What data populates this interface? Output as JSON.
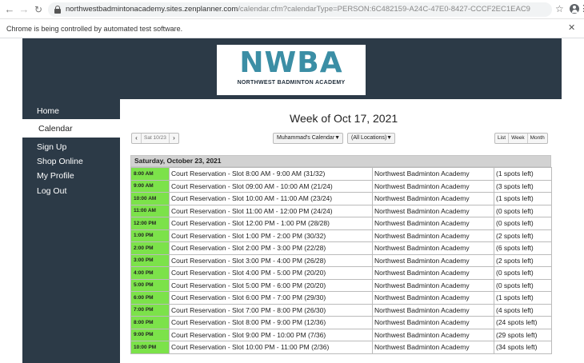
{
  "browser": {
    "url_domain": "northwestbadmintonacademy.sites.zenplanner.com",
    "url_path": "/calendar.cfm?calendarType=PERSON:6C482159-A24C-47E0-8427-CCCF2EC1EAC9",
    "infobar_text": "Chrome is being controlled by automated test software.",
    "icons": [
      "back-icon",
      "forward-icon",
      "reload-icon",
      "lock-icon",
      "star-icon",
      "profile-icon",
      "menu-icon",
      "close-icon"
    ]
  },
  "logo": {
    "text": "NWBA",
    "subtitle": "NORTHWEST BADMINTON ACADEMY"
  },
  "sidebar": {
    "items": [
      {
        "label": "Home"
      },
      {
        "label": "Calendar",
        "active": true
      },
      {
        "label": "Sign Up"
      },
      {
        "label": "Shop Online"
      },
      {
        "label": "My Profile"
      },
      {
        "label": "Log Out"
      }
    ]
  },
  "calendar": {
    "week_title": "Week of Oct 17, 2021",
    "date_nav": {
      "prev": "‹",
      "date": "Sat 10/23",
      "next": "›"
    },
    "calendar_select": "Muhammad's Calendar",
    "location_select": "(All Locations)",
    "views": [
      "List",
      "Week",
      "Month"
    ],
    "day_header": "Saturday, October 23, 2021",
    "rows": [
      {
        "time": "8:00 AM",
        "event": "Court Reservation - Slot 8:00 AM - 9:00 AM (31/32)",
        "location": "Northwest Badminton Academy",
        "spots": "(1 spots left)"
      },
      {
        "time": "9:00 AM",
        "event": "Court Reservation - Slot 09:00 AM - 10:00 AM (21/24)",
        "location": "Northwest Badminton Academy",
        "spots": "(3 spots left)"
      },
      {
        "time": "10:00 AM",
        "event": "Court Reservation - Slot 10:00 AM - 11:00 AM (23/24)",
        "location": "Northwest Badminton Academy",
        "spots": "(1 spots left)"
      },
      {
        "time": "11:00 AM",
        "event": "Court Reservation - Slot 11:00 AM - 12:00 PM (24/24)",
        "location": "Northwest Badminton Academy",
        "spots": "(0 spots left)"
      },
      {
        "time": "12:00 PM",
        "event": "Court Reservation - Slot 12:00 PM - 1:00 PM (28/28)",
        "location": "Northwest Badminton Academy",
        "spots": "(0 spots left)"
      },
      {
        "time": "1:00 PM",
        "event": "Court Reservation - Slot 1:00 PM - 2:00 PM (30/32)",
        "location": "Northwest Badminton Academy",
        "spots": "(2 spots left)"
      },
      {
        "time": "2:00 PM",
        "event": "Court Reservation - Slot 2:00 PM - 3:00 PM (22/28)",
        "location": "Northwest Badminton Academy",
        "spots": "(6 spots left)"
      },
      {
        "time": "3:00 PM",
        "event": "Court Reservation - Slot 3:00 PM - 4:00 PM (26/28)",
        "location": "Northwest Badminton Academy",
        "spots": "(2 spots left)"
      },
      {
        "time": "4:00 PM",
        "event": "Court Reservation - Slot 4:00 PM - 5:00 PM (20/20)",
        "location": "Northwest Badminton Academy",
        "spots": "(0 spots left)"
      },
      {
        "time": "5:00 PM",
        "event": "Court Reservation - Slot 5:00 PM - 6:00 PM (20/20)",
        "location": "Northwest Badminton Academy",
        "spots": "(0 spots left)"
      },
      {
        "time": "6:00 PM",
        "event": "Court Reservation - Slot 6:00 PM - 7:00 PM (29/30)",
        "location": "Northwest Badminton Academy",
        "spots": "(1 spots left)"
      },
      {
        "time": "7:00 PM",
        "event": "Court Reservation - Slot 7:00 PM - 8:00 PM (26/30)",
        "location": "Northwest Badminton Academy",
        "spots": "(4 spots left)"
      },
      {
        "time": "8:00 PM",
        "event": "Court Reservation - Slot 8:00 PM - 9:00 PM (12/36)",
        "location": "Northwest Badminton Academy",
        "spots": "(24 spots left)"
      },
      {
        "time": "9:00 PM",
        "event": "Court Reservation - Slot 9:00 PM - 10:00 PM (7/36)",
        "location": "Northwest Badminton Academy",
        "spots": "(29 spots left)"
      },
      {
        "time": "10:00 PM",
        "event": "Court Reservation - Slot 10:00 PM - 11:00 PM (2/36)",
        "location": "Northwest Badminton Academy",
        "spots": "(34 spots left)"
      }
    ]
  }
}
